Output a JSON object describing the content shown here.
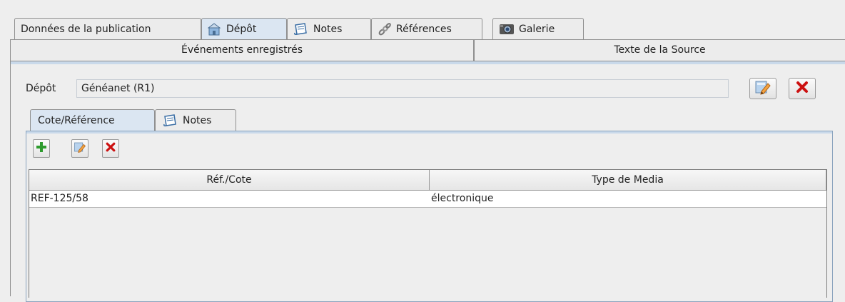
{
  "tabs": [
    {
      "label": "Données de la publication",
      "icon": "none",
      "selected": false
    },
    {
      "label": "Dépôt",
      "icon": "repository-icon",
      "selected": true
    },
    {
      "label": "Notes",
      "icon": "notes-icon",
      "selected": false
    },
    {
      "label": "Références",
      "icon": "link-icon",
      "selected": false
    },
    {
      "label": "Galerie",
      "icon": "gallery-icon",
      "selected": false
    }
  ],
  "tabs_row2": [
    "Événements enregistrés",
    "Texte de la Source"
  ],
  "repository": {
    "label": "Dépôt",
    "value": "Généanet (R1)",
    "edit_icon": "edit-icon",
    "delete_icon": "delete-icon"
  },
  "inner_tabs": [
    {
      "label": "Cote/Référence",
      "icon": "none",
      "selected": true
    },
    {
      "label": "Notes",
      "icon": "notes-icon",
      "selected": false
    }
  ],
  "toolbar": [
    "add-icon",
    "edit-icon",
    "delete-icon"
  ],
  "table": {
    "columns": [
      "Réf./Cote",
      "Type de Media"
    ],
    "rows": [
      [
        "REF-125/58",
        "électronique"
      ]
    ]
  },
  "colors": {
    "selected_tab": "#dbe6f2",
    "delete_red": "#cc1111",
    "add_green": "#2e9b2e"
  }
}
